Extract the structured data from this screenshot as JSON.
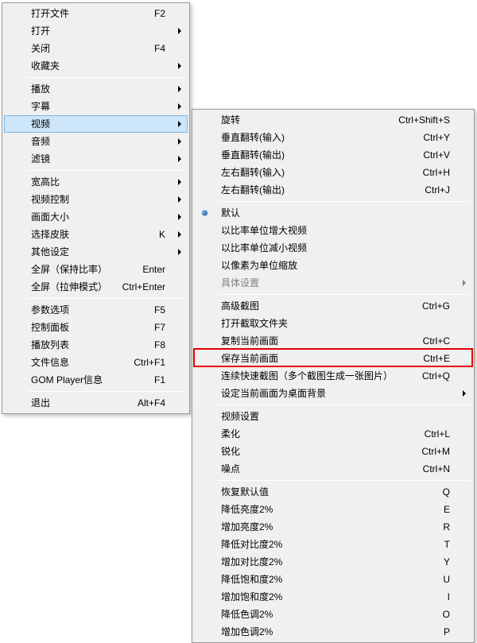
{
  "left_menu": {
    "groups": [
      [
        {
          "label": "打开文件",
          "shortcut": "F2"
        },
        {
          "label": "打开",
          "submenu": true
        },
        {
          "label": "关闭",
          "shortcut": "F4"
        },
        {
          "label": "收藏夹",
          "submenu": true
        }
      ],
      [
        {
          "label": "播放",
          "submenu": true
        },
        {
          "label": "字幕",
          "submenu": true
        },
        {
          "label": "视频",
          "submenu": true,
          "hover": true
        },
        {
          "label": "音频",
          "submenu": true
        },
        {
          "label": "滤镜",
          "submenu": true
        }
      ],
      [
        {
          "label": "宽高比",
          "submenu": true
        },
        {
          "label": "视频控制",
          "submenu": true
        },
        {
          "label": "画面大小",
          "submenu": true
        },
        {
          "label": "选择皮肤",
          "shortcut": "K",
          "submenu": true
        },
        {
          "label": "其他设定",
          "submenu": true
        },
        {
          "label": "全屏（保持比率）",
          "shortcut": "Enter"
        },
        {
          "label": "全屏（拉伸模式）",
          "shortcut": "Ctrl+Enter"
        }
      ],
      [
        {
          "label": "参数选项",
          "shortcut": "F5"
        },
        {
          "label": "控制面板",
          "shortcut": "F7"
        },
        {
          "label": "播放列表",
          "shortcut": "F8"
        },
        {
          "label": "文件信息",
          "shortcut": "Ctrl+F1"
        },
        {
          "label": "GOM Player信息",
          "shortcut": "F1"
        }
      ],
      [
        {
          "label": "退出",
          "shortcut": "Alt+F4"
        }
      ]
    ]
  },
  "right_menu": {
    "groups": [
      [
        {
          "label": "旋转",
          "shortcut": "Ctrl+Shift+S"
        },
        {
          "label": "垂直翻转(输入)",
          "shortcut": "Ctrl+Y"
        },
        {
          "label": "垂直翻转(输出)",
          "shortcut": "Ctrl+V"
        },
        {
          "label": "左右翻转(输入)",
          "shortcut": "Ctrl+H"
        },
        {
          "label": "左右翻转(输出)",
          "shortcut": "Ctrl+J"
        }
      ],
      [
        {
          "label": "默认",
          "radio": true
        },
        {
          "label": "以比率单位增大视频"
        },
        {
          "label": "以比率单位减小视频"
        },
        {
          "label": "以像素为单位缩放"
        },
        {
          "label": "具体设置",
          "submenu": true,
          "disabled": true
        }
      ],
      [
        {
          "label": "高级截图",
          "shortcut": "Ctrl+G"
        },
        {
          "label": "打开截取文件夹"
        },
        {
          "label": "复制当前画面",
          "shortcut": "Ctrl+C"
        },
        {
          "label": "保存当前画面",
          "shortcut": "Ctrl+E",
          "highlight": true
        },
        {
          "label": "连续快速截图（多个截图生成一张图片）",
          "shortcut": "Ctrl+Q"
        },
        {
          "label": "设定当前画面为桌面背景",
          "submenu": true
        }
      ],
      [
        {
          "label": "视频设置"
        },
        {
          "label": "柔化",
          "shortcut": "Ctrl+L"
        },
        {
          "label": "锐化",
          "shortcut": "Ctrl+M"
        },
        {
          "label": "噪点",
          "shortcut": "Ctrl+N"
        }
      ],
      [
        {
          "label": "恢复默认值",
          "shortcut": "Q"
        },
        {
          "label": "降低亮度2%",
          "shortcut": "E"
        },
        {
          "label": "增加亮度2%",
          "shortcut": "R"
        },
        {
          "label": "降低对比度2%",
          "shortcut": "T"
        },
        {
          "label": "增加对比度2%",
          "shortcut": "Y"
        },
        {
          "label": "降低饱和度2%",
          "shortcut": "U"
        },
        {
          "label": "增加饱和度2%",
          "shortcut": "I"
        },
        {
          "label": "降低色调2%",
          "shortcut": "O"
        },
        {
          "label": "增加色调2%",
          "shortcut": "P"
        }
      ]
    ]
  }
}
